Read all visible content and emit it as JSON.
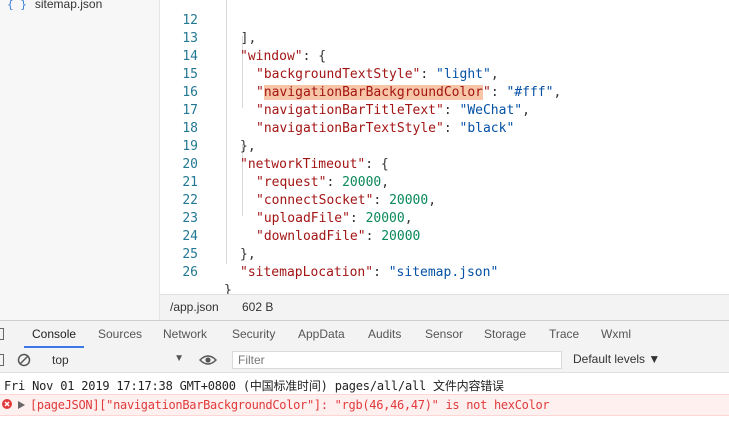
{
  "sidebar": {
    "file_name": "sitemap.json"
  },
  "editor": {
    "lines": [
      {
        "num": "12",
        "text": "  ],"
      },
      {
        "num": "13",
        "key": "\"window\"",
        "rest": ": {"
      },
      {
        "num": "14",
        "key": "\"backgroundTextStyle\"",
        "colon": ": ",
        "str": "\"light\"",
        "end": ","
      },
      {
        "num": "15",
        "q": "\"",
        "hl": "navigationBarBackgroundColor",
        "q2": "\"",
        "colon": ": ",
        "str": "\"#fff\"",
        "end": ","
      },
      {
        "num": "16",
        "key": "\"navigationBarTitleText\"",
        "colon": ": ",
        "str": "\"WeChat\"",
        "end": ","
      },
      {
        "num": "17",
        "key": "\"navigationBarTextStyle\"",
        "colon": ": ",
        "str": "\"black\""
      },
      {
        "num": "18",
        "text": "},"
      },
      {
        "num": "19",
        "key": "\"networkTimeout\"",
        "rest": ": {"
      },
      {
        "num": "20",
        "key": "\"request\"",
        "colon": ": ",
        "numval": "20000",
        "end": ","
      },
      {
        "num": "21",
        "key": "\"connectSocket\"",
        "colon": ": ",
        "numval": "20000",
        "end": ","
      },
      {
        "num": "22",
        "key": "\"uploadFile\"",
        "colon": ": ",
        "numval": "20000",
        "end": ","
      },
      {
        "num": "23",
        "key": "\"downloadFile\"",
        "colon": ": ",
        "numval": "20000"
      },
      {
        "num": "24",
        "text": "},"
      },
      {
        "num": "25",
        "key": "\"sitemapLocation\"",
        "colon": ": ",
        "str": "\"sitemap.json\""
      },
      {
        "num": "26",
        "text": "}"
      }
    ]
  },
  "statusbar": {
    "path": "/app.json",
    "size": "602 B"
  },
  "devtools": {
    "tabs": [
      "Console",
      "Sources",
      "Network",
      "Security",
      "AppData",
      "Audits",
      "Sensor",
      "Storage",
      "Trace",
      "Wxml"
    ],
    "context": "top",
    "filter_placeholder": "Filter",
    "levels": "Default levels ▼",
    "log_message": "Fri Nov 01 2019 17:17:38 GMT+0800 (中国标准时间) pages/all/all 文件内容错误",
    "error_message": "[pageJSON][\"navigationBarBackgroundColor\"]: \"rgb(46,46,47)\" is not hexColor"
  },
  "colors": {
    "json_key": "#a31515",
    "json_string": "#0451a5",
    "json_number": "#09885a",
    "error": "#e03a3a",
    "accent": "#3b78e7"
  }
}
